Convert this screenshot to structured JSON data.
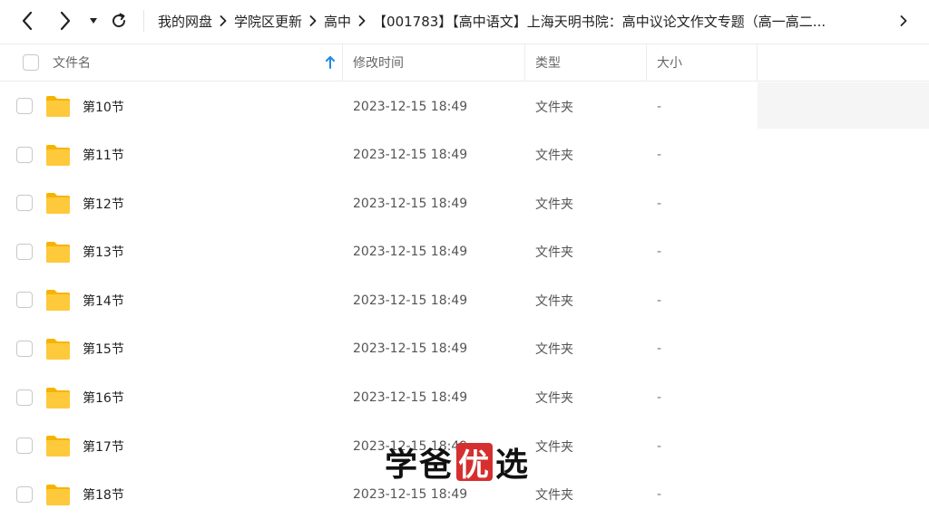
{
  "breadcrumb": [
    "我的网盘",
    "学院区更新",
    "高中",
    "【001783】【高中语文】上海天明书院：高中议论文作文专题（高一高二..."
  ],
  "header": {
    "name": "文件名",
    "time": "修改时间",
    "type": "类型",
    "size": "大小"
  },
  "rows": [
    {
      "name": "第10节",
      "time": "2023-12-15 18:49",
      "type": "文件夹",
      "size": "-"
    },
    {
      "name": "第11节",
      "time": "2023-12-15 18:49",
      "type": "文件夹",
      "size": "-"
    },
    {
      "name": "第12节",
      "time": "2023-12-15 18:49",
      "type": "文件夹",
      "size": "-"
    },
    {
      "name": "第13节",
      "time": "2023-12-15 18:49",
      "type": "文件夹",
      "size": "-"
    },
    {
      "name": "第14节",
      "time": "2023-12-15 18:49",
      "type": "文件夹",
      "size": "-"
    },
    {
      "name": "第15节",
      "time": "2023-12-15 18:49",
      "type": "文件夹",
      "size": "-"
    },
    {
      "name": "第16节",
      "time": "2023-12-15 18:49",
      "type": "文件夹",
      "size": "-"
    },
    {
      "name": "第17节",
      "time": "2023-12-15 18:49",
      "type": "文件夹",
      "size": "-"
    },
    {
      "name": "第18节",
      "time": "2023-12-15 18:49",
      "type": "文件夹",
      "size": "-"
    }
  ],
  "watermark": {
    "part1": "学爸",
    "part2": "优",
    "part3": "选"
  },
  "icons": {
    "back": "chevron-left-icon",
    "forward": "chevron-right-icon",
    "history": "caret-down-icon",
    "refresh": "refresh-icon",
    "sort": "arrow-up-icon",
    "folder": "folder-icon"
  },
  "colors": {
    "folder": "#ffc93c",
    "accent": "#1e88e5",
    "watermark_box": "#d62f2f"
  }
}
